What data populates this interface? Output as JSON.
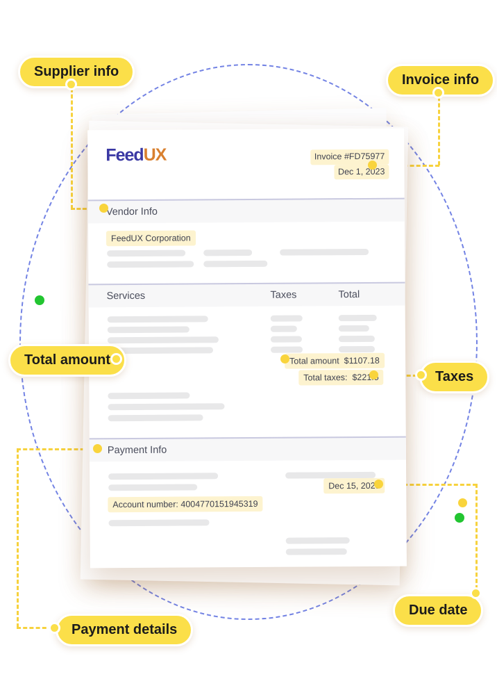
{
  "background": {
    "gradient_from": "#fcdcb6",
    "gradient_to": "#efa662",
    "accent_yellow": "#fbdf49",
    "guide_circle_color": "#5b6ee0",
    "guide_dot_color": "#22c531"
  },
  "callouts": [
    {
      "id": "supplier-info",
      "label": "Supplier info"
    },
    {
      "id": "invoice-info",
      "label": "Invoice info"
    },
    {
      "id": "total-amount",
      "label": "Total amount"
    },
    {
      "id": "taxes",
      "label": "Taxes"
    },
    {
      "id": "payment-details",
      "label": "Payment details"
    },
    {
      "id": "due-date",
      "label": "Due date"
    }
  ],
  "document": {
    "logo": {
      "part1": "Feed",
      "part2": "UX"
    },
    "invoice_number": "Invoice #FD75977",
    "invoice_date": "Dec 1, 2023",
    "vendor_section": {
      "title": "Vendor Info",
      "company": "FeedUX Corporation"
    },
    "services_table": {
      "columns": [
        "Services",
        "Taxes",
        "Total"
      ]
    },
    "totals": {
      "total_amount_label": "Total amount",
      "total_amount_value": "$1107.18",
      "total_taxes_label": "Total taxes:",
      "total_taxes_value": "$221.5"
    },
    "payment_section": {
      "title": "Payment Info",
      "account_number": "Account number: 4004770151945319",
      "due_date": "Dec 15, 2023"
    }
  }
}
